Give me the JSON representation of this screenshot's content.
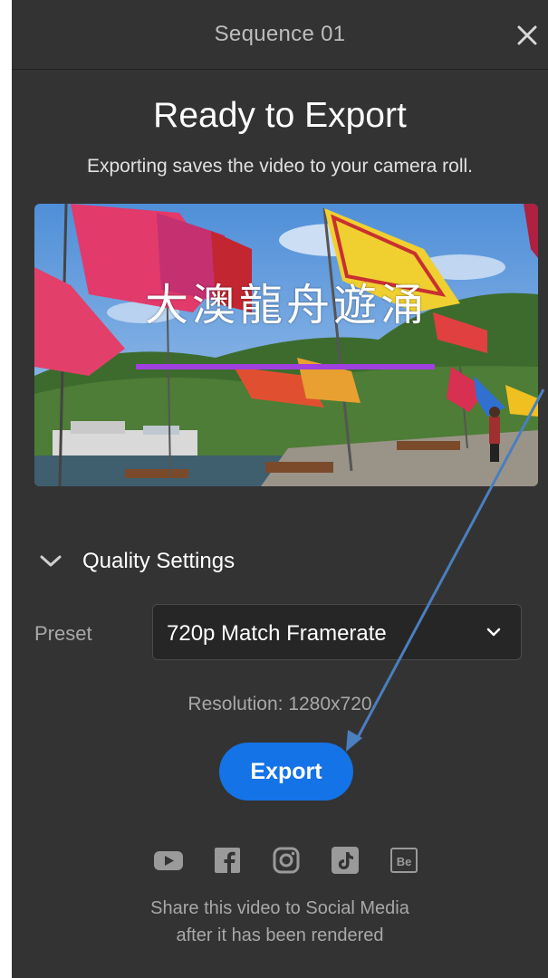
{
  "header": {
    "title": "Sequence 01",
    "close_icon": "close-icon"
  },
  "main": {
    "heading": "Ready to Export",
    "subheading": "Exporting saves the video to your camera roll.",
    "preview": {
      "caption": "大澳龍舟遊涌",
      "caption_underline_color": "#a040e0"
    },
    "quality": {
      "section_label": "Quality Settings",
      "expand_icon": "chevron-down-icon",
      "preset_label": "Preset",
      "preset_value": "720p Match Framerate",
      "resolution": "Resolution: 1280x720"
    },
    "export_label": "Export",
    "share": {
      "icons": [
        "youtube-icon",
        "facebook-icon",
        "instagram-icon",
        "tiktok-icon",
        "behance-icon"
      ],
      "line1": "Share this video to Social Media",
      "line2": "after it has been rendered"
    }
  },
  "colors": {
    "background": "#333333",
    "accent": "#1473e6",
    "annotation_arrow": "#4a7fc0"
  }
}
